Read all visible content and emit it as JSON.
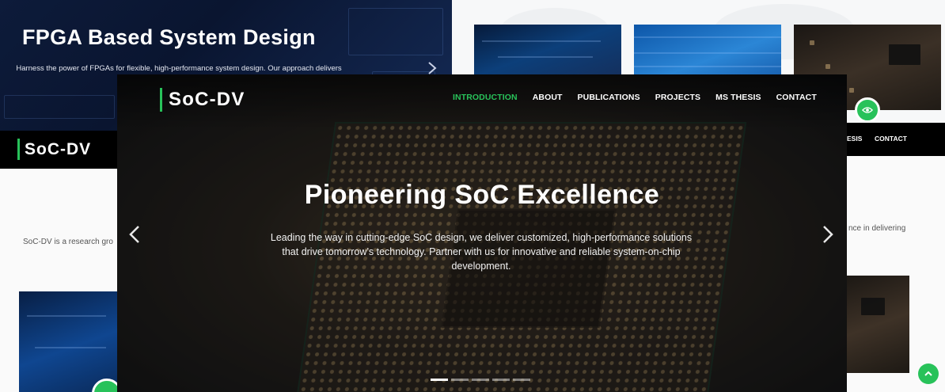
{
  "background": {
    "hero": {
      "title": "FPGA Based System Design",
      "text": "Harness the power of FPGAs for flexible, high-performance system design. Our approach delivers customized, scalable solutions fo"
    },
    "logo": "SoC-DV",
    "nav_partial": [
      "ESIS",
      "CONTACT"
    ],
    "para_left": "SoC-DV is a research gro",
    "para_right": "nce in delivering"
  },
  "foreground": {
    "logo": "SoC-DV",
    "nav": [
      {
        "label": "INTRODUCTION",
        "active": true
      },
      {
        "label": "ABOUT",
        "active": false
      },
      {
        "label": "PUBLICATIONS",
        "active": false
      },
      {
        "label": "PROJECTS",
        "active": false
      },
      {
        "label": "MS THESIS",
        "active": false
      },
      {
        "label": "CONTACT",
        "active": false
      }
    ],
    "hero": {
      "title": "Pioneering SoC Excellence",
      "text": "Leading the way in cutting-edge SoC design, we deliver customized, high-performance solutions that drive tomorrow’s technology. Partner with us for innovative and reliable system-on-chip development."
    },
    "carousel": {
      "slides": 5,
      "active_index": 0
    }
  },
  "colors": {
    "accent": "#28c25a",
    "nav_bg": "#000000",
    "text_light": "#ffffff"
  },
  "icons": [
    "chevron-left-icon",
    "chevron-right-icon",
    "eye-icon",
    "chevron-up-icon"
  ]
}
